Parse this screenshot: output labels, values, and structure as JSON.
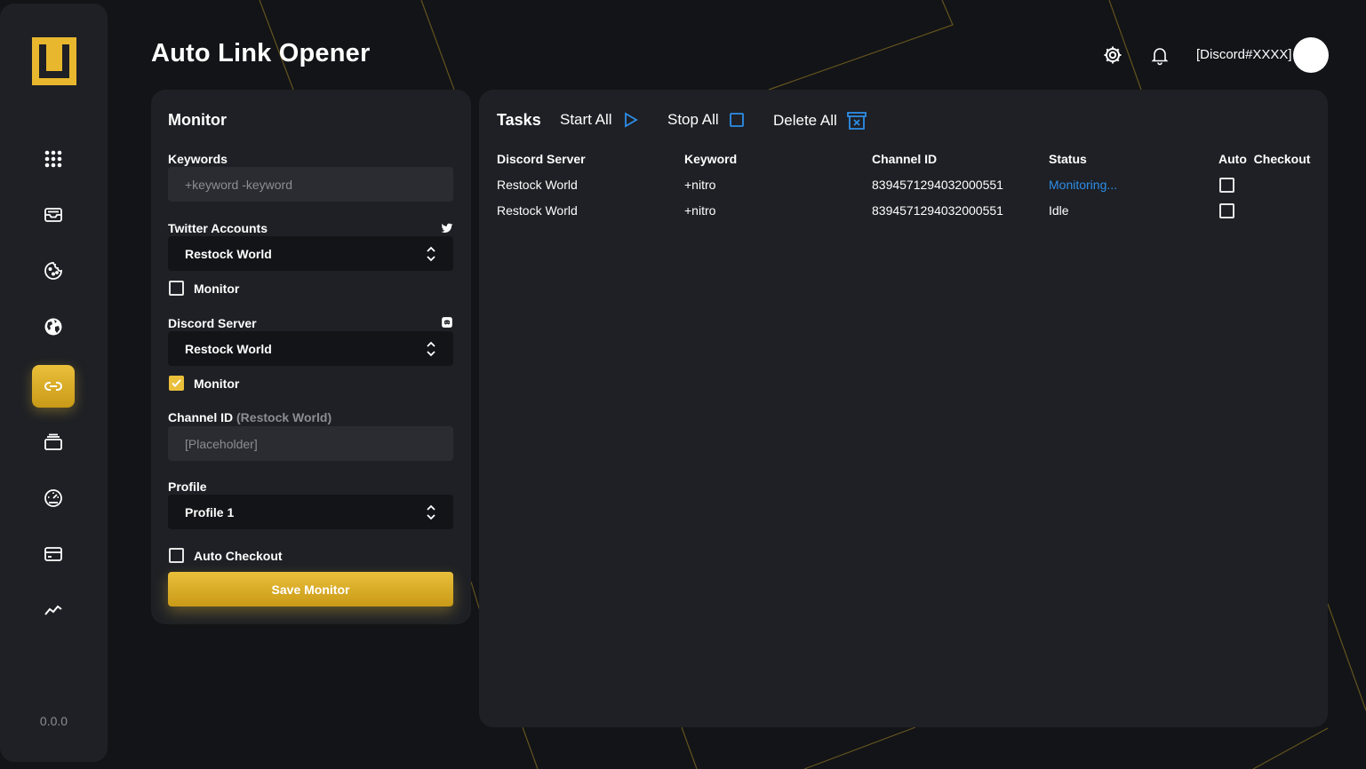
{
  "app": {
    "title": "Auto Link Opener",
    "version": "0.0.0",
    "user": "[Discord#XXXX]",
    "accent": "#eabf3a",
    "link_color": "#2d8ee8"
  },
  "sidebar": {
    "items": [
      {
        "icon": "grid-icon",
        "active": false
      },
      {
        "icon": "inbox-icon",
        "active": false
      },
      {
        "icon": "cookie-icon",
        "active": false
      },
      {
        "icon": "globe-icon",
        "active": false
      },
      {
        "icon": "link-icon",
        "active": true
      },
      {
        "icon": "stack-icon",
        "active": false
      },
      {
        "icon": "speedometer-icon",
        "active": false
      },
      {
        "icon": "credit-card-icon",
        "active": false
      },
      {
        "icon": "analytics-icon",
        "active": false
      }
    ]
  },
  "monitor": {
    "title": "Monitor",
    "keywords_label": "Keywords",
    "keywords_placeholder": "+keyword -keyword",
    "twitter_label": "Twitter Accounts",
    "twitter_value": "Restock World",
    "twitter_monitor_label": "Monitor",
    "twitter_monitor_checked": false,
    "discord_label": "Discord Server",
    "discord_value": "Restock World",
    "discord_monitor_label": "Monitor",
    "discord_monitor_checked": true,
    "channel_label": "Channel ID",
    "channel_label_server": "(Restock World)",
    "channel_placeholder": "[Placeholder]",
    "profile_label": "Profile",
    "profile_value": "Profile 1",
    "auto_checkout_label": "Auto Checkout",
    "auto_checkout_checked": false,
    "save_label": "Save Monitor"
  },
  "tasks": {
    "title": "Tasks",
    "start_all": "Start All",
    "stop_all": "Stop All",
    "delete_all": "Delete All",
    "columns": [
      "Discord Server",
      "Keyword",
      "Channel ID",
      "Status",
      "Auto  Checkout"
    ],
    "rows": [
      {
        "server": "Restock World",
        "keyword": "+nitro",
        "channel_id": "8394571294032000551",
        "status": "Monitoring...",
        "auto_checkout": false
      },
      {
        "server": "Restock World",
        "keyword": "+nitro",
        "channel_id": "8394571294032000551",
        "status": "Idle",
        "auto_checkout": false
      }
    ]
  }
}
